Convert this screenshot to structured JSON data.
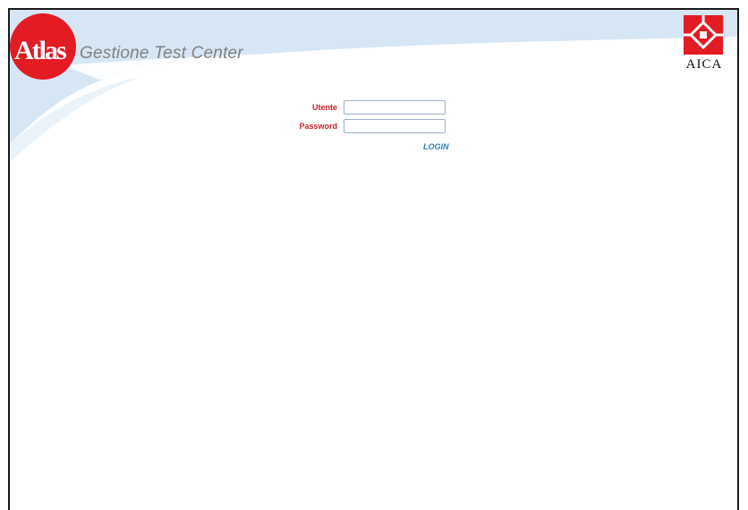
{
  "header": {
    "logo_wordmark": "Atlas",
    "subtitle": "Gestione Test Center",
    "partner_logo_text": "AICA"
  },
  "login": {
    "user_label": "Utente",
    "user_value": "",
    "password_label": "Password",
    "password_value": "",
    "submit_label": "LOGIN"
  },
  "colors": {
    "brand_red": "#e31b23",
    "label_red": "#cc1f2a",
    "link_blue": "#2f7bc4",
    "header_band": "#d6e6f5",
    "subtitle_grey": "#808080"
  },
  "icons": {
    "atlas_logo": "atlas-logo-red-circle",
    "aica_logo": "aica-logo-red-diamond"
  }
}
